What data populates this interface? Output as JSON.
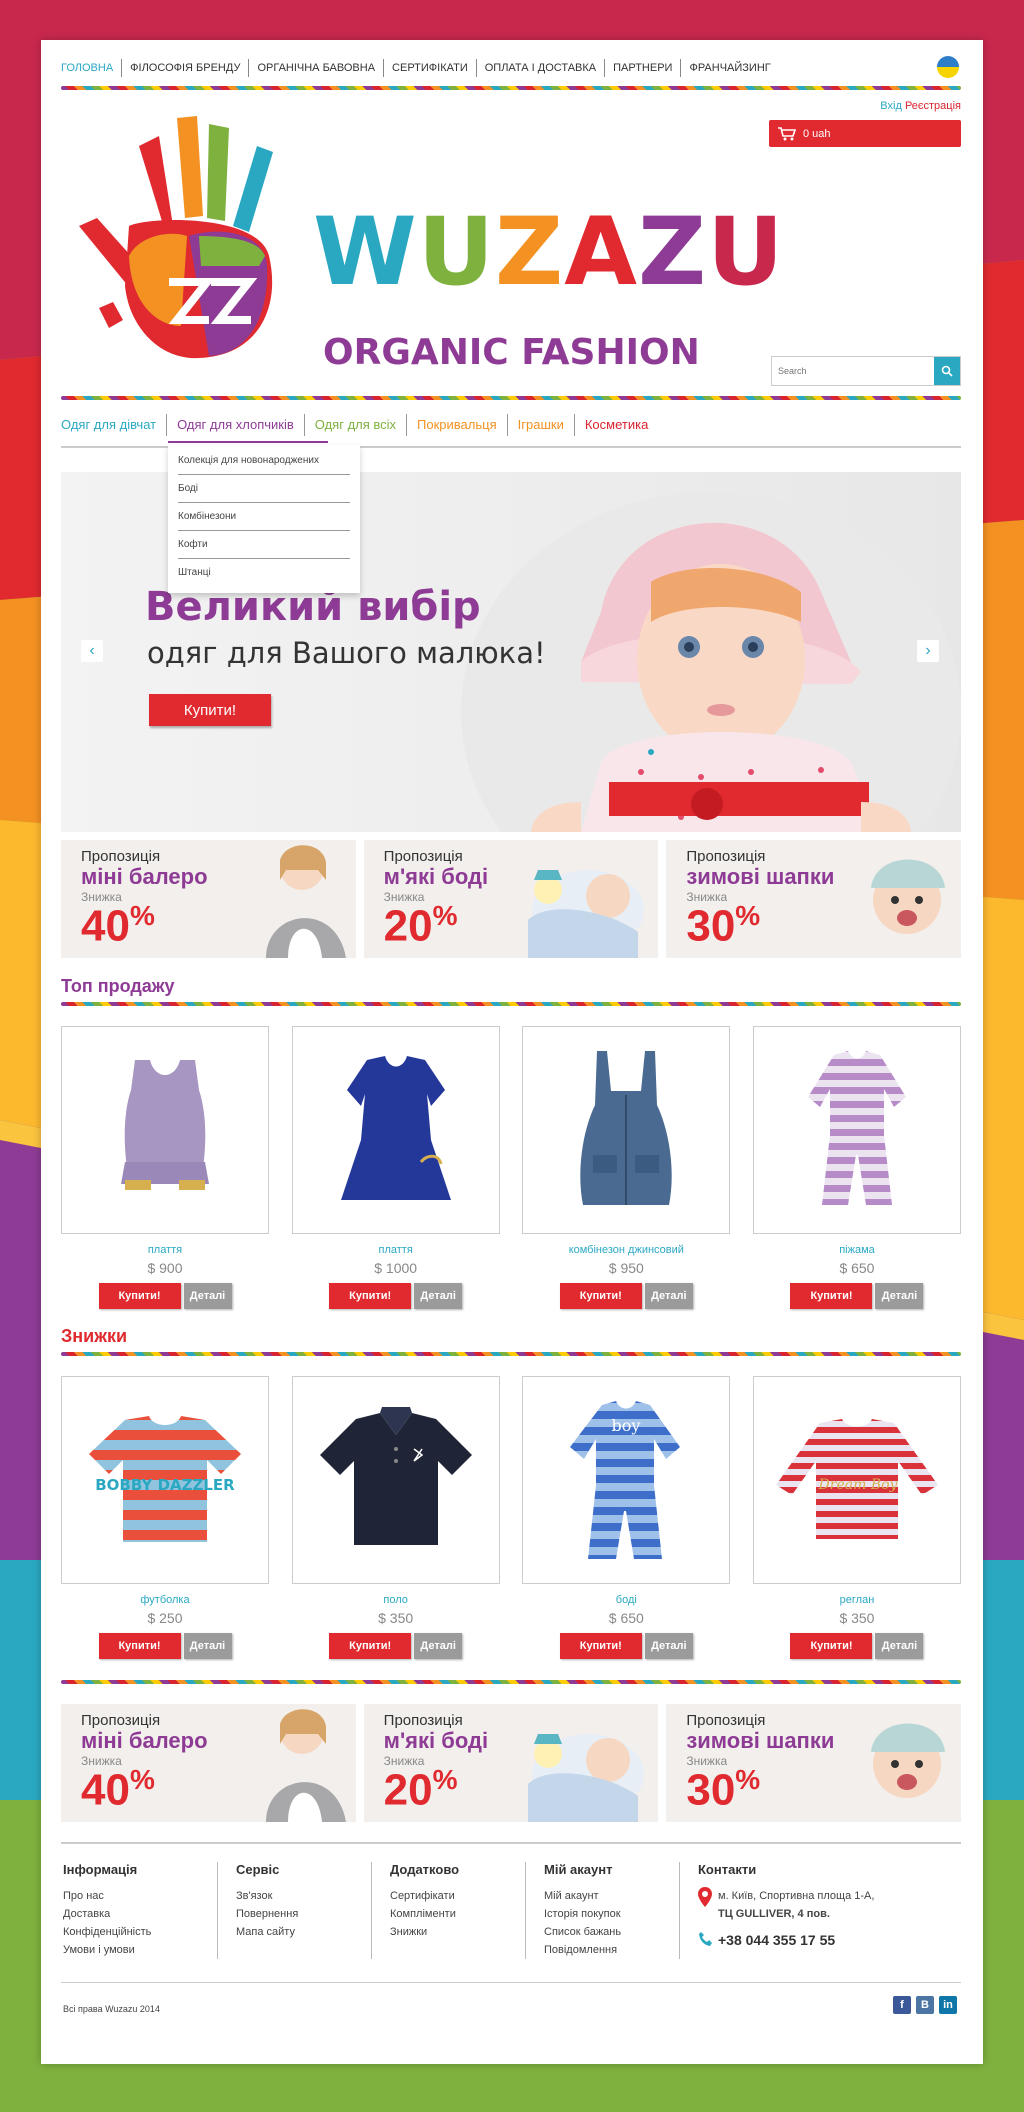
{
  "top_nav": [
    "ГОЛОВНА",
    "ФІЛОСОФІЯ БРЕНДУ",
    "ОРГАНІЧНА БАВОВНА",
    "СЕРТИФІКАТИ",
    "ОПЛАТА І ДОСТАВКА",
    "ПАРТНЕРИ",
    "ФРАНЧАЙЗИНГ"
  ],
  "auth": {
    "login": "Вхід",
    "register": "Реєстрація"
  },
  "cart": {
    "label": "0 uah"
  },
  "brand": {
    "name": "WUZAZU",
    "tagline": "ORGANIC FASHION",
    "hand_letters": "ZZ"
  },
  "search": {
    "placeholder": "Search"
  },
  "categories": [
    {
      "label": "Одяг для дівчат",
      "color": "#2aa8c2"
    },
    {
      "label": "Одяг для хлопчиків",
      "color": "#8e3b95"
    },
    {
      "label": "Одяг для всіх",
      "color": "#7fb13f"
    },
    {
      "label": "Покривальця",
      "color": "#f39222"
    },
    {
      "label": "Іграшки",
      "color": "#f39222"
    },
    {
      "label": "Косметика",
      "color": "#d9242f"
    }
  ],
  "dropdown": [
    "Колекція для новонароджених",
    "Боді",
    "Комбінезони",
    "Кофти",
    "Штанці"
  ],
  "hero": {
    "title": "Великий вибір",
    "subtitle": "одяг для Вашого малюка!",
    "button": "Купити!",
    "prev": "‹",
    "next": "›"
  },
  "promos": [
    {
      "label": "Пропозиція",
      "title": "міні балеро",
      "discount_label": "Знижка",
      "percent": "40",
      "pct": "%"
    },
    {
      "label": "Пропозиція",
      "title": "м'які боді",
      "discount_label": "Знижка",
      "percent": "20",
      "pct": "%"
    },
    {
      "label": "Пропозиція",
      "title": "зимові шапки",
      "discount_label": "Знижка",
      "percent": "30",
      "pct": "%"
    }
  ],
  "top_sales": {
    "title": "Топ продажу",
    "items": [
      {
        "name": "плаття",
        "price": "$ 900",
        "buy": "Купити!",
        "details": "Деталі"
      },
      {
        "name": "плаття",
        "price": "$ 1000",
        "buy": "Купити!",
        "details": "Деталі"
      },
      {
        "name": "комбінезон джинсовий",
        "price": "$ 950",
        "buy": "Купити!",
        "details": "Деталі"
      },
      {
        "name": "піжама",
        "price": "$ 650",
        "buy": "Купити!",
        "details": "Деталі"
      }
    ]
  },
  "discounts": {
    "title": "Знижки",
    "items": [
      {
        "name": "футболка",
        "price": "$ 250",
        "buy": "Купити!",
        "details": "Деталі",
        "print": "BOBBY DAZZLER"
      },
      {
        "name": "поло",
        "price": "$ 350",
        "buy": "Купити!",
        "details": "Деталі"
      },
      {
        "name": "боді",
        "price": "$ 650",
        "buy": "Купити!",
        "details": "Деталі",
        "print": "boy"
      },
      {
        "name": "реглан",
        "price": "$ 350",
        "buy": "Купити!",
        "details": "Деталі",
        "print": "Dream Boy"
      }
    ]
  },
  "footer": {
    "columns": [
      {
        "title": "Інформація",
        "links": [
          "Про нас",
          "Доставка",
          "Конфіденційність",
          "Умови і умови"
        ]
      },
      {
        "title": "Сервіс",
        "links": [
          "Зв'язок",
          "Повернення",
          "Мапа сайту"
        ]
      },
      {
        "title": "Додатково",
        "links": [
          "Сертифікати",
          "Компліменти",
          "Знижки"
        ]
      },
      {
        "title": "Мій акаунт",
        "links": [
          "Мій акаунт",
          "Історія покупок",
          "Список бажань",
          "Повідомлення"
        ]
      }
    ],
    "contacts": {
      "title": "Контакти",
      "address1": "м. Київ, Спортивна площа 1-А,",
      "address2": "ТЦ GULLIVER, 4 пов.",
      "phone": "+38 044 355 17 55"
    },
    "copyright": "Всі права Wuzazu 2014",
    "social": [
      "f",
      "B",
      "in"
    ]
  },
  "colors": {
    "purple": "#8e3b95",
    "red": "#e02a2f",
    "teal": "#2aa8c2",
    "orange": "#f39222",
    "green": "#7fb13f",
    "yellow": "#ffcb05"
  },
  "icons": [
    "cart-icon",
    "search-icon",
    "ukraine-flag-icon",
    "map-pin-icon",
    "phone-icon",
    "facebook-icon",
    "vk-icon",
    "linkedin-icon"
  ]
}
